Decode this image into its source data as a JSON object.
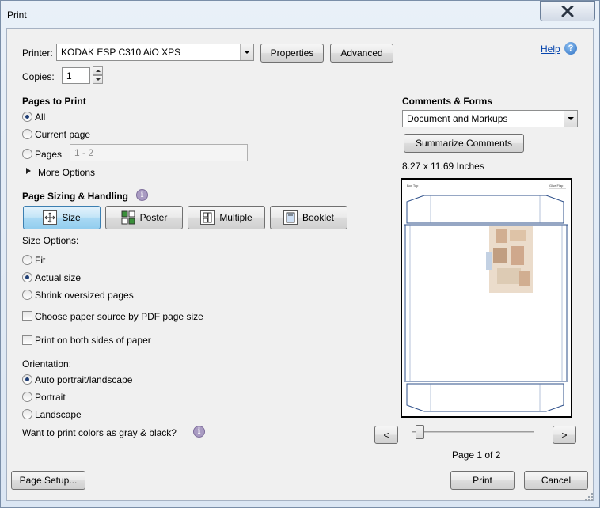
{
  "window": {
    "title": "Print",
    "close_glyph": "✕"
  },
  "printer": {
    "label": "Printer:",
    "value": "KODAK ESP C310 AiO XPS",
    "properties_label": "Properties",
    "advanced_label": "Advanced",
    "help_label": "Help"
  },
  "copies": {
    "label": "Copies:",
    "value": "1"
  },
  "pages_to_print": {
    "heading": "Pages to Print",
    "all_label": "All",
    "current_label": "Current page",
    "pages_label": "Pages",
    "pages_placeholder": "1 - 2",
    "more_options_label": "More Options",
    "selected": "all"
  },
  "page_sizing": {
    "heading": "Page Sizing & Handling",
    "buttons": [
      {
        "label": "Size",
        "icon": "size-icon",
        "active": true
      },
      {
        "label": "Poster",
        "icon": "poster-icon",
        "active": false
      },
      {
        "label": "Multiple",
        "icon": "multiple-icon",
        "active": false
      },
      {
        "label": "Booklet",
        "icon": "booklet-icon",
        "active": false
      }
    ],
    "size_options_label": "Size Options:",
    "fit_label": "Fit",
    "actual_size_label": "Actual size",
    "shrink_label": "Shrink oversized pages",
    "selected": "actual",
    "paper_source_label": "Choose paper source by PDF page size",
    "both_sides_label": "Print on both sides of paper"
  },
  "orientation": {
    "label": "Orientation:",
    "auto_label": "Auto portrait/landscape",
    "portrait_label": "Portrait",
    "landscape_label": "Landscape",
    "selected": "auto"
  },
  "gray_question": "Want to print colors as gray & black?",
  "comments_forms": {
    "heading": "Comments & Forms",
    "value": "Document and Markups",
    "summarize_label": "Summarize Comments",
    "page_size": "8.27 x 11.69 Inches"
  },
  "preview": {
    "header_left": "Box Top",
    "header_right": "Glue Flap"
  },
  "nav": {
    "prev": "<",
    "next": ">",
    "page_indicator": "Page 1 of 2",
    "slider_position": 0.02
  },
  "footer": {
    "page_setup_label": "Page Setup...",
    "print_label": "Print",
    "cancel_label": "Cancel"
  }
}
